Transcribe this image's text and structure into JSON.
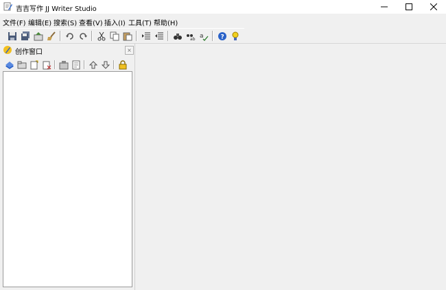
{
  "window": {
    "title": "吉吉写作 JJ Writer Studio",
    "controls": {
      "minimize": "—",
      "maximize": "☐",
      "close": "✕"
    }
  },
  "menu": {
    "items": [
      {
        "label": "文件(F)"
      },
      {
        "label": "编辑(E)"
      },
      {
        "label": "搜索(S)"
      },
      {
        "label": "查看(V)"
      },
      {
        "label": "插入(I)"
      },
      {
        "label": "工具(T)"
      },
      {
        "label": "帮助(H)"
      }
    ]
  },
  "toolbar": {
    "buttons": [
      {
        "icon": "save-icon"
      },
      {
        "icon": "save-all-icon"
      },
      {
        "icon": "export-icon"
      },
      {
        "icon": "broom-icon"
      },
      {
        "icon": "undo-icon"
      },
      {
        "icon": "redo-icon"
      },
      {
        "icon": "cut-icon"
      },
      {
        "icon": "copy-icon"
      },
      {
        "icon": "paste-icon"
      },
      {
        "icon": "indent-icon"
      },
      {
        "icon": "outdent-icon"
      },
      {
        "icon": "find-icon"
      },
      {
        "icon": "replace-icon"
      },
      {
        "icon": "spellcheck-icon"
      },
      {
        "icon": "help-icon"
      },
      {
        "icon": "tip-icon"
      }
    ]
  },
  "panel": {
    "title": "创作窗口",
    "close": "×",
    "tools": [
      {
        "icon": "book-icon"
      },
      {
        "icon": "folder-icon"
      },
      {
        "icon": "new-doc-icon"
      },
      {
        "icon": "delete-doc-icon"
      },
      {
        "icon": "properties-icon"
      },
      {
        "icon": "notes-icon"
      },
      {
        "icon": "move-up-icon"
      },
      {
        "icon": "move-down-icon"
      },
      {
        "icon": "lock-icon"
      }
    ]
  },
  "colors": {
    "chrome": "#f0f0f0",
    "tree_bg": "#ffffff",
    "accent_blue": "#2a62c8"
  }
}
